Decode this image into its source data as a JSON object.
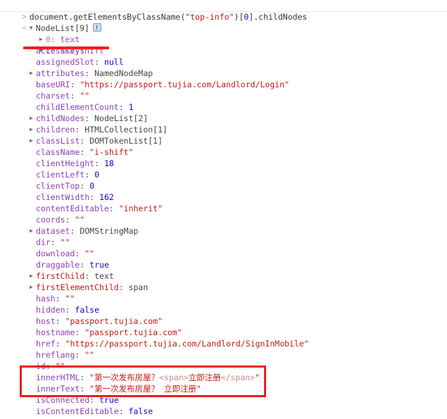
{
  "console": {
    "prompt_glyph": ">",
    "return_glyph": "<",
    "tri_open": "▼",
    "tri_closed": "▶",
    "input_line": "document.getElementsByClassName(\"top-info\")[0].childNodes",
    "input_parts": {
      "expr_a": "document.getElementsByClassName(",
      "string": "\"top-info\"",
      "expr_b": ")[",
      "index": "0",
      "expr_c": "].childNodes"
    },
    "result_label": "NodeList[9]",
    "info_icon": "info-icon"
  },
  "nodes": [
    {
      "index": "0:",
      "name": "text"
    },
    {
      "index": "1:",
      "name": "a.i-shift"
    }
  ],
  "properties": [
    {
      "name": "accessKey",
      "sep": ": ",
      "value": "\"\"",
      "vtype": "str",
      "arrow": false
    },
    {
      "name": "assignedSlot",
      "sep": ": ",
      "value": "null",
      "vtype": "null",
      "arrow": false
    },
    {
      "name": "attributes",
      "sep": ": ",
      "value": "NamedNodeMap",
      "vtype": "obj",
      "arrow": true
    },
    {
      "name": "baseURI",
      "sep": ": ",
      "value": "\"https://passport.tujia.com/Landlord/Login\"",
      "vtype": "str",
      "arrow": false
    },
    {
      "name": "charset",
      "sep": ": ",
      "value": "\"\"",
      "vtype": "str",
      "arrow": false
    },
    {
      "name": "childElementCount",
      "sep": ": ",
      "value": "1",
      "vtype": "num",
      "arrow": false
    },
    {
      "name": "childNodes",
      "sep": ": ",
      "value": "NodeList[2]",
      "vtype": "obj",
      "arrow": true
    },
    {
      "name": "children",
      "sep": ": ",
      "value": "HTMLCollection[1]",
      "vtype": "obj",
      "arrow": true
    },
    {
      "name": "classList",
      "sep": ": ",
      "value": "DOMTokenList[1]",
      "vtype": "obj",
      "arrow": true
    },
    {
      "name": "className",
      "sep": ": ",
      "value": "\"i-shift\"",
      "vtype": "str",
      "arrow": false
    },
    {
      "name": "clientHeight",
      "sep": ": ",
      "value": "18",
      "vtype": "num",
      "arrow": false
    },
    {
      "name": "clientLeft",
      "sep": ": ",
      "value": "0",
      "vtype": "num",
      "arrow": false
    },
    {
      "name": "clientTop",
      "sep": ": ",
      "value": "0",
      "vtype": "num",
      "arrow": false
    },
    {
      "name": "clientWidth",
      "sep": ": ",
      "value": "162",
      "vtype": "num",
      "arrow": false
    },
    {
      "name": "contentEditable",
      "sep": ": ",
      "value": "\"inherit\"",
      "vtype": "str",
      "arrow": false
    },
    {
      "name": "coords",
      "sep": ": ",
      "value": "\"\"",
      "vtype": "str",
      "arrow": false
    },
    {
      "name": "dataset",
      "sep": ": ",
      "value": "DOMStringMap",
      "vtype": "obj",
      "arrow": true
    },
    {
      "name": "dir",
      "sep": ": ",
      "value": "\"\"",
      "vtype": "str",
      "arrow": false
    },
    {
      "name": "download",
      "sep": ": ",
      "value": "\"\"",
      "vtype": "str",
      "arrow": false
    },
    {
      "name": "draggable",
      "sep": ": ",
      "value": "true",
      "vtype": "bool",
      "arrow": false
    },
    {
      "name": "firstChild",
      "sep": ": ",
      "value": "text",
      "vtype": "obj",
      "arrow": true,
      "nameColor": "red"
    },
    {
      "name": "firstElementChild",
      "sep": ": ",
      "value": "span",
      "vtype": "obj",
      "arrow": true,
      "nameColor": "red"
    },
    {
      "name": "hash",
      "sep": ": ",
      "value": "\"\"",
      "vtype": "str",
      "arrow": false
    },
    {
      "name": "hidden",
      "sep": ": ",
      "value": "false",
      "vtype": "bool",
      "arrow": false
    },
    {
      "name": "host",
      "sep": ": ",
      "value": "\"passport.tujia.com\"",
      "vtype": "str",
      "arrow": false
    },
    {
      "name": "hostname",
      "sep": ": ",
      "value": "\"passport.tujia.com\"",
      "vtype": "str",
      "arrow": false
    },
    {
      "name": "href",
      "sep": ": ",
      "value": "\"https://passport.tujia.com/Landlord/SignInMobile\"",
      "vtype": "str",
      "arrow": false
    },
    {
      "name": "hreflang",
      "sep": ": ",
      "value": "\"\"",
      "vtype": "str",
      "arrow": false
    },
    {
      "name": "id",
      "sep": ": ",
      "value": "\"\"",
      "vtype": "str",
      "arrow": false
    },
    {
      "name": "innerHTML",
      "sep": ": ",
      "value": "\"第一次发布房屋？<span>立即注册</span>\"",
      "vtype": "str-html",
      "arrow": false
    },
    {
      "name": "innerText",
      "sep": ": ",
      "value": "\"第一次发布房屋？ 立即注册\"",
      "vtype": "str",
      "arrow": false
    },
    {
      "name": "isConnected",
      "sep": ": ",
      "value": "true",
      "vtype": "bool",
      "arrow": false
    },
    {
      "name": "isContentEditable",
      "sep": ": ",
      "value": "false",
      "vtype": "bool",
      "arrow": false
    }
  ],
  "innerhtml_parts": {
    "open_quote": "\"",
    "text_before": "第一次发布房屋？",
    "tag_open": "<span>",
    "text_inner": "立即注册",
    "tag_close": "</span>",
    "close_quote": "\""
  },
  "annotations": {
    "underline": {
      "label": "red-underline-on-a-i-shift"
    },
    "box": {
      "label": "red-highlight-box-innerhtml-innertext"
    },
    "color": "#ee1c1c"
  }
}
